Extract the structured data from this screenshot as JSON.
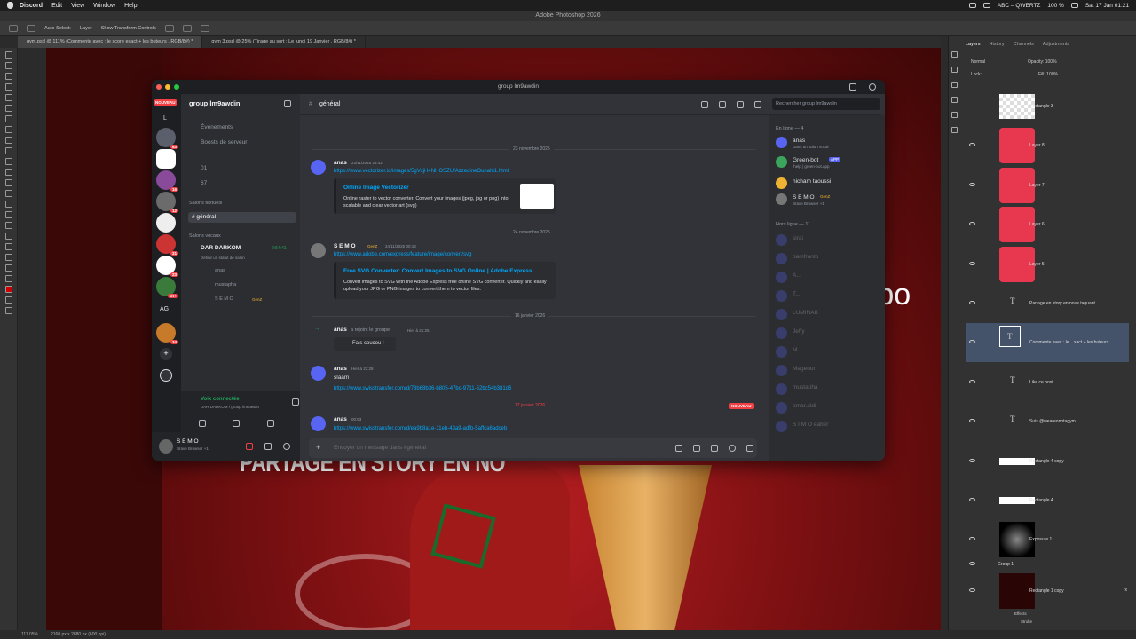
{
  "menubar": {
    "app": "Discord",
    "items": [
      "Edit",
      "View",
      "Window",
      "Help"
    ],
    "keyboard": "ABC – QWERTZ",
    "battery": "100 %",
    "datetime": "Sat 17 Jan 01:21"
  },
  "photoshop": {
    "title": "Adobe Photoshop 2026",
    "options": {
      "auto_select": "Auto-Select:",
      "layer": "Layer",
      "transform": "Show Transform Controls"
    },
    "tabs": [
      "gym.psd @ 111% (Commente avec : le score exact + les buteurs , RGB/8#) *",
      "gym 3.psd @ 25% (Tirage au sort : Le lundi 19 Janvier , RGB/8#) *"
    ],
    "canvas_text": {
      "story": "PARTAGE EN STORY EN NO",
      "partial": "ce po"
    },
    "status": {
      "zoom": "111.05%",
      "dims": "2160 px x 2880 px (600 ppi)"
    },
    "panel_tabs": [
      "Layers",
      "History",
      "Channels",
      "Adjustments"
    ],
    "blend_mode": "Normal",
    "opacity_label": "Opacity:",
    "opacity": "100%",
    "fill_label": "Fill:",
    "fill": "100%",
    "lock_label": "Lock:",
    "layers": [
      {
        "name": "Rectangle 3",
        "kind": "rect-white"
      },
      {
        "name": "Layer 8",
        "kind": "icon"
      },
      {
        "name": "Layer 7",
        "kind": "icon"
      },
      {
        "name": "Layer 6",
        "kind": "icon"
      },
      {
        "name": "Layer 5",
        "kind": "icon"
      },
      {
        "name": "Partage en story en nous taguant",
        "kind": "text"
      },
      {
        "name": "Commente avec : le ...xact + les buteurs",
        "kind": "text"
      },
      {
        "name": "Like ce post",
        "kind": "text"
      },
      {
        "name": "Suis @weareonotagym",
        "kind": "text"
      },
      {
        "name": "Rectangle 4 copy",
        "kind": "rect"
      },
      {
        "name": "Rectangle 4",
        "kind": "rect"
      },
      {
        "name": "Exposure 1",
        "kind": "adj"
      },
      {
        "name": "Group 1",
        "kind": "group"
      },
      {
        "name": "Rectangle 1 copy",
        "kind": "dark"
      }
    ],
    "effects": "Effects",
    "stroke": "Stroke",
    "fx": "fx"
  },
  "discord": {
    "window_title": "group lm9awdin",
    "server_name": "group lm9awdin",
    "new_badge": "NOUVEAU",
    "server_letters": [
      "L",
      "AG"
    ],
    "server_badges": [
      "63",
      "16",
      "12",
      "31",
      "23",
      "1K+",
      "34"
    ],
    "nav": [
      {
        "label": "Événements"
      },
      {
        "label": "Boosts de serveur"
      }
    ],
    "voice_top": [
      "01",
      "67"
    ],
    "text_section": "Salons textuels",
    "text_channel": "général",
    "voice_section": "Salons vocaux",
    "voice_channel": "DAR DARKOM",
    "voice_time": "2:54:41",
    "voice_status": "Définir un statut de salon",
    "voice_members": [
      "anas",
      "mustapha",
      "S E M O"
    ],
    "voice_tag": "GenZ",
    "voice_connected": "Voix connectée",
    "voice_location": "DAR DARKOM / group lm9awdin",
    "user": {
      "name": "S E M O",
      "status": "Brave Browser +1"
    },
    "channel_header": "général",
    "search_placeholder": "Rechercher group lm9awdin",
    "messages": {
      "d1": "23 novembre 2025",
      "m1_user": "anas",
      "m1_time": "23/11/2025 23:42",
      "m1_link": "https://www.vectorizer.io/images/5gVxjH4NHOSZU/AzzedineOunahi1.html",
      "m1_embed_title": "Online Image Vectorizer",
      "m1_embed_desc": "Online raster to vector converter. Convert your images (jpeg, jpg or png) into scalable and clear vector art (svg)",
      "d2": "24 novembre 2025",
      "m2_user": "S E M O",
      "m2_tag": "GenZ",
      "m2_time": "24/11/2025 00:13",
      "m2_link": "https://www.adobe.com/express/feature/image/convert/svg",
      "m2_embed_title": "Free SVG Converter: Convert Images to SVG Online | Adobe Express",
      "m2_embed_desc": "Convert images to SVG with the Adobe Express free online SVG converter. Quickly and easily upload your JPG or PNG images to convert them to vector files.",
      "d3": "16 janvier 2026",
      "join_user": "anas",
      "join_text": "a rejoint le groupe.",
      "join_time": "Hier à 21:25",
      "wave": "Fais coucou !",
      "m3_user": "anas",
      "m3_time": "Hier à 22:28",
      "m3_text": "slaam",
      "m3_link": "https://www.swisstransfer.com/d/78b68b36-b805-47bc-9711-52bc54b381d6",
      "d4": "17 janvier 2026",
      "new_label": "NOUVEAU",
      "m4_user": "anas",
      "m4_time": "00:53",
      "m4_link": "https://www.swisstransfer.com/d/ea9b8a1e-11eb-43a9-adfb-5affca6adceb"
    },
    "input_placeholder": "Envoyer un message dans #général",
    "members": {
      "online_header": "En ligne — 4",
      "online": [
        {
          "name": "anas",
          "sub": "Dans un salon vocal"
        },
        {
          "name": "Green-bot",
          "sub": "/help | green-bot.app",
          "tag": "APP"
        },
        {
          "name": "hicham taoussi",
          "sub": ""
        },
        {
          "name": "S E M O",
          "sub": "Brave Browser +1",
          "tag": "GenZ"
        }
      ],
      "offline_header": "Hors ligne — 11",
      "offline": [
        "sirai",
        "bamfranto",
        "A...",
        "T...",
        "LUMINAK",
        "Jeffy",
        "M...",
        "Mageoun",
        "mustapha",
        "omar.aldi",
        "S I M O eaber"
      ]
    }
  }
}
